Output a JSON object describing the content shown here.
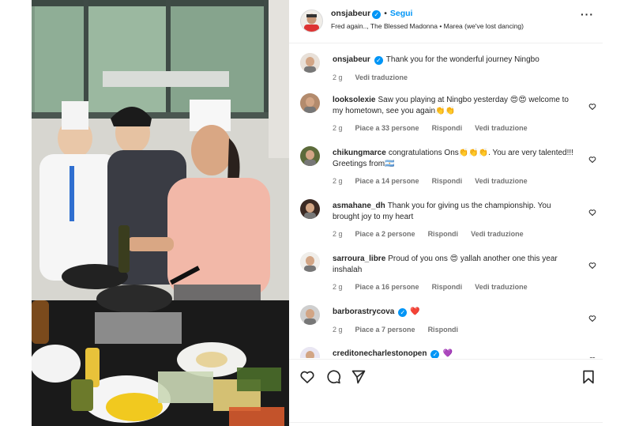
{
  "post": {
    "username": "onsjabeur",
    "follow_label": "Segui",
    "audio": "Fred again.., The Blessed Madonna • Marea (we've lost dancing)"
  },
  "comments": [
    {
      "username": "onsjabeur",
      "text": "Thank you for the wonderful journey Ningbo",
      "time": "2 g",
      "likes": "",
      "reply": "",
      "translate": "Vedi traduzione",
      "verified": true,
      "has_heart": false
    },
    {
      "username": "looksolexie",
      "text": "Saw you playing at Ningbo yesterday 😍😍 welcome to my hometown, see you again👏👏",
      "time": "2 g",
      "likes": "Piace a 33 persone",
      "reply": "Rispondi",
      "translate": "Vedi traduzione",
      "verified": false,
      "has_heart": true
    },
    {
      "username": "chikungmarce",
      "text": "congratulations Ons👏👏👏. You are very talented!!! Greetings from🇦🇷",
      "time": "2 g",
      "likes": "Piace a 14 persone",
      "reply": "Rispondi",
      "translate": "Vedi traduzione",
      "verified": false,
      "has_heart": true
    },
    {
      "username": "asmahane_dh",
      "text": "Thank you for giving us the championship. You brought joy to my heart",
      "time": "2 g",
      "likes": "Piace a 2 persone",
      "reply": "Rispondi",
      "translate": "Vedi traduzione",
      "verified": false,
      "has_heart": true
    },
    {
      "username": "sarroura_libre",
      "text": "Proud of you ons 😍 yallah another one this year inshalah",
      "time": "2 g",
      "likes": "Piace a 16 persone",
      "reply": "Rispondi",
      "translate": "Vedi traduzione",
      "verified": false,
      "has_heart": true
    },
    {
      "username": "barborastrycova",
      "text": "❤️",
      "time": "2 g",
      "likes": "Piace a 7 persone",
      "reply": "Rispondi",
      "translate": "",
      "verified": true,
      "has_heart": true
    },
    {
      "username": "creditonecharlestonopen",
      "text": "💜",
      "time": "",
      "likes": "",
      "reply": "",
      "translate": "",
      "verified": true,
      "has_heart": true
    }
  ],
  "icons": {
    "like": "heart-icon",
    "comment": "comment-icon",
    "share": "share-icon",
    "save": "bookmark-icon",
    "more": "more-icon"
  },
  "colors": {
    "accent": "#0095f6",
    "text": "#262626",
    "muted": "#737373",
    "border": "#efefef"
  }
}
